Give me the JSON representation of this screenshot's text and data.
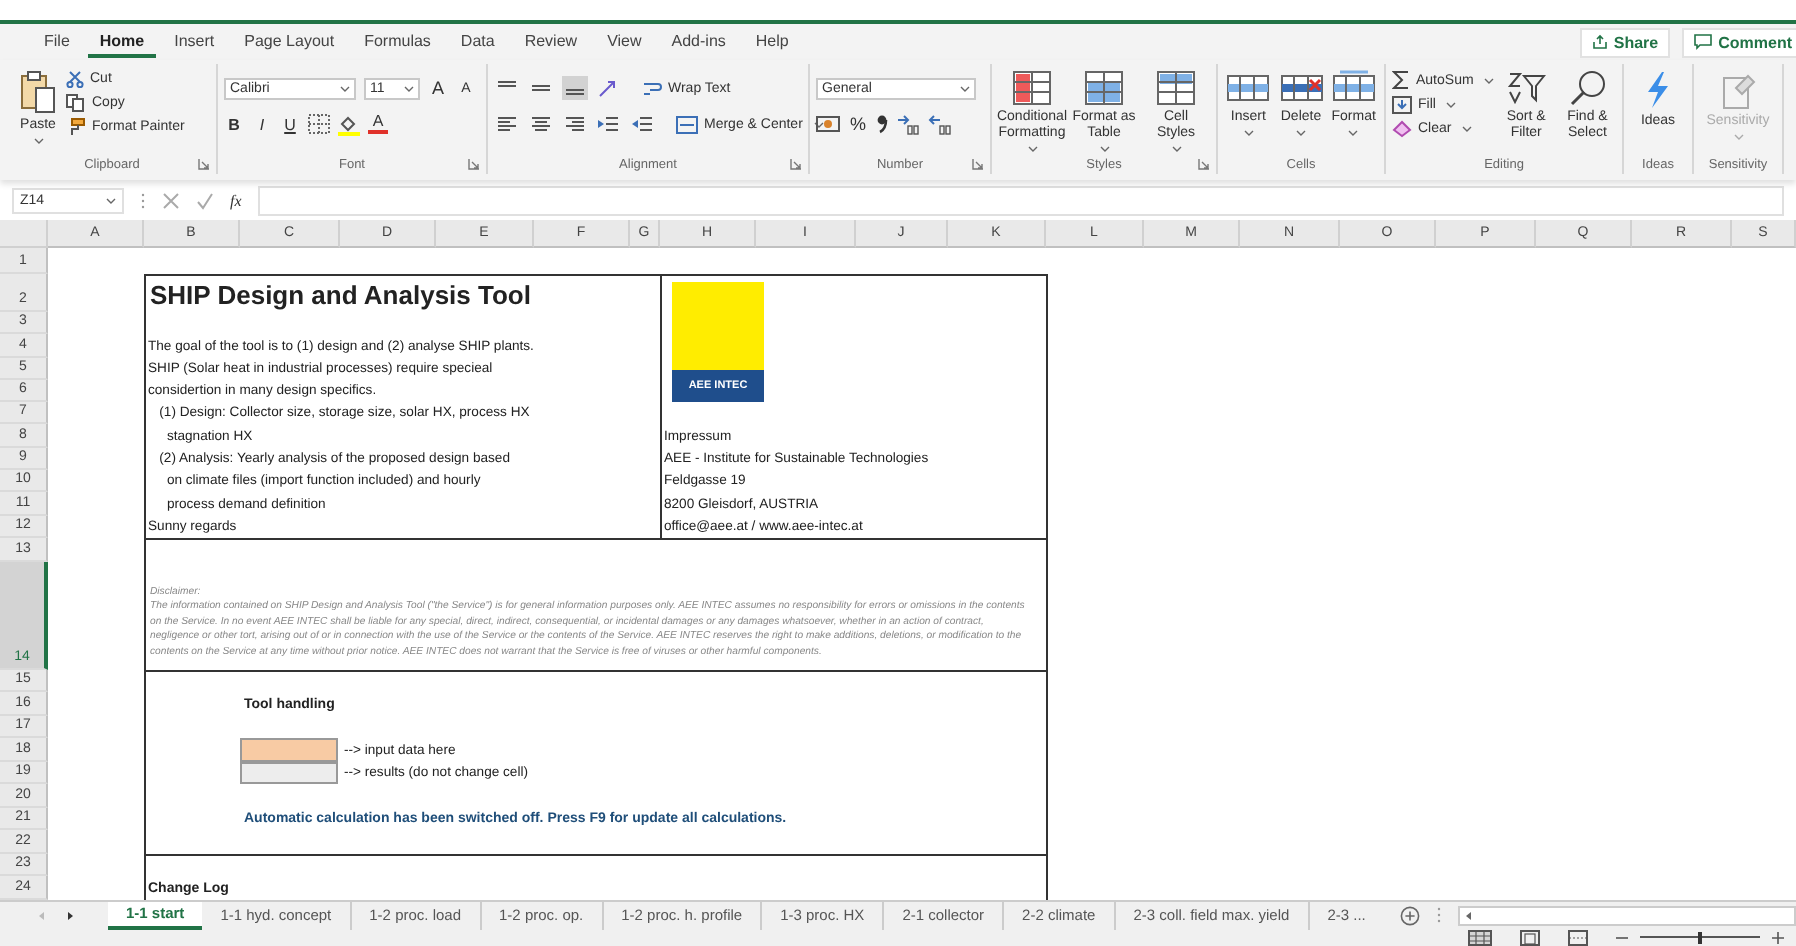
{
  "menu_tabs": [
    {
      "label": "File",
      "selected": false
    },
    {
      "label": "Home",
      "selected": true
    },
    {
      "label": "Insert",
      "selected": false
    },
    {
      "label": "Page Layout",
      "selected": false
    },
    {
      "label": "Formulas",
      "selected": false
    },
    {
      "label": "Data",
      "selected": false
    },
    {
      "label": "Review",
      "selected": false
    },
    {
      "label": "View",
      "selected": false
    },
    {
      "label": "Add-ins",
      "selected": false
    },
    {
      "label": "Help",
      "selected": false
    }
  ],
  "share": "Share",
  "comments": "Comment",
  "ribbon": [
    {
      "kind": "clipboard",
      "label": "Clipboard",
      "paste": "Paste",
      "items": [
        "Cut",
        "Copy",
        "Format Painter"
      ]
    },
    {
      "kind": "font",
      "label": "Font",
      "font": "Calibri",
      "size": "11",
      "grow": "A",
      "shrink": "A",
      "styles": [
        "B",
        "I",
        "U"
      ],
      "color_letter": "A"
    },
    {
      "kind": "alignment",
      "label": "Alignment",
      "wrap": "Wrap Text",
      "merge": "Merge & Center"
    },
    {
      "kind": "number",
      "label": "Number",
      "format": "General",
      "percent": "%"
    },
    {
      "kind": "large",
      "label": "Styles",
      "buttons": [
        {
          "lines": [
            "Conditional",
            "Formatting"
          ]
        },
        {
          "lines": [
            "Format as",
            "Table"
          ]
        },
        {
          "lines": [
            "Cell",
            "Styles"
          ]
        }
      ]
    },
    {
      "kind": "large",
      "label": "Cells",
      "buttons": [
        {
          "lines": [
            "Insert"
          ]
        },
        {
          "lines": [
            "Delete"
          ]
        },
        {
          "lines": [
            "Format"
          ]
        }
      ]
    },
    {
      "kind": "editing",
      "label": "Editing",
      "items": [
        "AutoSum",
        "Fill",
        "Clear"
      ],
      "buttons": [
        {
          "lines": [
            "Sort &",
            "Filter"
          ]
        },
        {
          "lines": [
            "Find &",
            "Select"
          ]
        }
      ]
    },
    {
      "kind": "ideas",
      "label": "Ideas",
      "button": "Ideas"
    },
    {
      "kind": "sensitivity",
      "label": "Sensitivity",
      "button": "Sensitivity",
      "disabled": true
    }
  ],
  "formula_bar": {
    "name_box": "Z14",
    "fx": "fx"
  },
  "columns": [
    "A",
    "B",
    "C",
    "D",
    "E",
    "F",
    "G",
    "H",
    "I",
    "J",
    "K",
    "L",
    "M",
    "N",
    "O",
    "P",
    "Q",
    "R",
    "S"
  ],
  "rows": [
    {
      "label": "1",
      "selected": false
    },
    {
      "label": "2",
      "selected": false
    },
    {
      "label": "3",
      "selected": false
    },
    {
      "label": "4",
      "selected": false
    },
    {
      "label": "5",
      "selected": false
    },
    {
      "label": "6",
      "selected": false
    },
    {
      "label": "7",
      "selected": false
    },
    {
      "label": "8",
      "selected": false
    },
    {
      "label": "9",
      "selected": false
    },
    {
      "label": "10",
      "selected": false
    },
    {
      "label": "11",
      "selected": false
    },
    {
      "label": "12",
      "selected": false
    },
    {
      "label": "13",
      "selected": false
    },
    {
      "label": "14",
      "selected": true
    },
    {
      "label": "15",
      "selected": false
    },
    {
      "label": "16",
      "selected": false
    },
    {
      "label": "17",
      "selected": false
    },
    {
      "label": "18",
      "selected": false
    },
    {
      "label": "19",
      "selected": false
    },
    {
      "label": "20",
      "selected": false
    },
    {
      "label": "21",
      "selected": false
    },
    {
      "label": "22",
      "selected": false
    },
    {
      "label": "23",
      "selected": false
    },
    {
      "label": "24",
      "selected": false
    }
  ],
  "sheet": {
    "title": "SHIP Design and Analysis Tool",
    "intro_lines": [
      "The goal of the tool is to (1) design and (2) analyse SHIP plants.",
      "SHIP (Solar heat in industrial processes) require specieal",
      "considertion in many design specifics.",
      "   (1) Design: Collector size, storage size, solar HX, process HX",
      "     stagnation HX",
      "   (2) Analysis: Yearly analysis of the proposed design based",
      "     on climate files (import function included) and hourly",
      "     process demand definition",
      "Sunny regards"
    ],
    "logo_text": "AEE INTEC",
    "imprint_lines": [
      "Impressum",
      "AEE - Institute for Sustainable Technologies",
      "Feldgasse 19",
      "8200 Gleisdorf, AUSTRIA",
      "office@aee.at / www.aee-intec.at"
    ],
    "disclaimer_heading": "Disclaimer:",
    "disclaimer": "The information contained on SHIP Design and Analysis Tool (\"the Service\") is for general information purposes only. AEE INTEC assumes no responsibility for errors or omissions in the contents on the Service. In no event AEE INTEC shall be liable for any special, direct, indirect, consequential, or incidental damages or any damages whatsoever, whether in an action of contract, negligence or other tort, arising out of or in connection with the use of the Service or the contents of the Service. AEE INTEC reserves the right to make additions, deletions, or modification to the contents on the Service at any time without prior notice. AEE INTEC does not warrant that the Service is free of viruses or other harmful components.",
    "tool_handling": "Tool handling",
    "legend": [
      {
        "label": "--> input data here",
        "color": "#f8cba4"
      },
      {
        "label": "--> results (do not change cell)",
        "color": "#ededed"
      }
    ],
    "notice": "Automatic calculation has been switched off. Press F9 for update all calculations.",
    "change_log": "Change Log"
  },
  "sheet_tabs": [
    {
      "label": "1-1 start",
      "selected": true
    },
    {
      "label": "1-1 hyd. concept",
      "selected": false
    },
    {
      "label": "1-2 proc. load",
      "selected": false
    },
    {
      "label": "1-2 proc. op.",
      "selected": false
    },
    {
      "label": "1-2 proc. h. profile",
      "selected": false
    },
    {
      "label": "1-3 proc. HX",
      "selected": false
    },
    {
      "label": "2-1 collector",
      "selected": false
    },
    {
      "label": "2-2 climate",
      "selected": false
    },
    {
      "label": "2-3 coll. field max. yield",
      "selected": false
    },
    {
      "label": "2-3 ...",
      "selected": false
    }
  ],
  "zoom_slider": {
    "level": 0.5
  }
}
